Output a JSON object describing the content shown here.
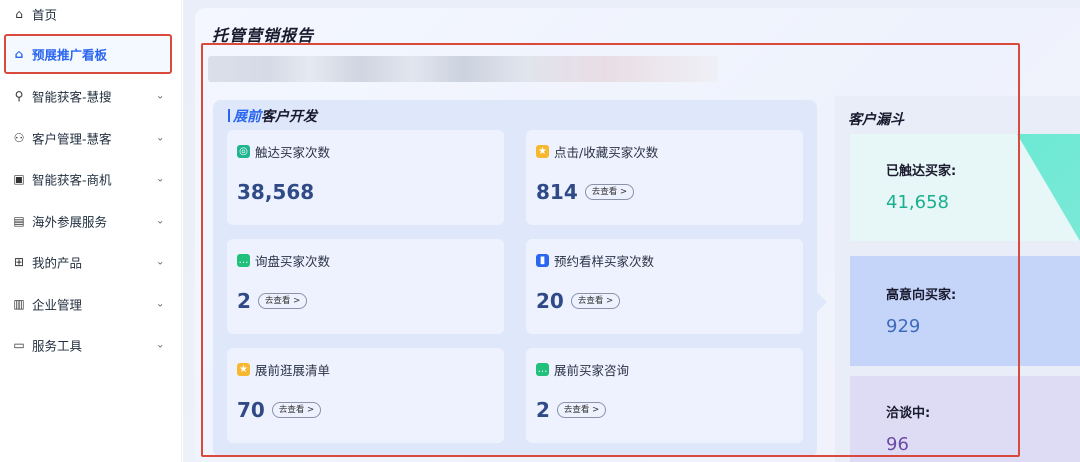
{
  "sidebar": {
    "items": [
      {
        "label": "首页",
        "icon": "home-icon",
        "glyph": "⌂",
        "chevron": ""
      },
      {
        "label": "预展推广看板",
        "icon": "dashboard-icon",
        "glyph": "⌂",
        "chevron": ""
      },
      {
        "label": "智能获客-慧搜",
        "icon": "smart-search-icon",
        "glyph": "⚲",
        "chevron": "⌄"
      },
      {
        "label": "客户管理-慧客",
        "icon": "customer-icon",
        "glyph": "⚇",
        "chevron": "⌄"
      },
      {
        "label": "智能获客-商机",
        "icon": "opportunity-icon",
        "glyph": "▣",
        "chevron": "⌄"
      },
      {
        "label": "海外参展服务",
        "icon": "clipboard-icon",
        "glyph": "▤",
        "chevron": "⌄"
      },
      {
        "label": "我的产品",
        "icon": "product-icon",
        "glyph": "⊞",
        "chevron": "⌄"
      },
      {
        "label": "企业管理",
        "icon": "building-icon",
        "glyph": "▥",
        "chevron": "⌄"
      },
      {
        "label": "服务工具",
        "icon": "toolbox-icon",
        "glyph": "▭",
        "chevron": "⌄"
      }
    ],
    "active_index": 1
  },
  "report": {
    "title": "托管营销报告"
  },
  "section": {
    "title_accent": "展前",
    "title_rest": "客户开发",
    "link_label": "去查看 >",
    "cards": [
      {
        "label": "触达买家次数",
        "value": "38,568",
        "icon": "reach-icon",
        "icon_color": "#1fb58f",
        "glyph": "◎",
        "has_link": false
      },
      {
        "label": "点击/收藏买家次数",
        "value": "814",
        "icon": "star-icon",
        "icon_color": "#f5b82e",
        "glyph": "★",
        "has_link": true
      },
      {
        "label": "询盘买家次数",
        "value": "2",
        "icon": "message-icon",
        "icon_color": "#21c17c",
        "glyph": "…",
        "has_link": true
      },
      {
        "label": "预约看样买家次数",
        "value": "20",
        "icon": "bag-icon",
        "icon_color": "#2a66f0",
        "glyph": "▮",
        "has_link": true
      },
      {
        "label": "展前逛展清单",
        "value": "70",
        "icon": "star-icon",
        "icon_color": "#f5b82e",
        "glyph": "★",
        "has_link": true
      },
      {
        "label": "展前买家咨询",
        "value": "2",
        "icon": "chat-icon",
        "icon_color": "#21c17c",
        "glyph": "…",
        "has_link": true
      }
    ]
  },
  "funnel": {
    "title": "客户漏斗",
    "stages": [
      {
        "label": "已触达买家:",
        "value": "41,658",
        "color": "#19b08e"
      },
      {
        "label": "高意向买家:",
        "value": "929",
        "color": "#3f6bb8"
      },
      {
        "label": "洽谈中:",
        "value": "96",
        "color": "#6b4aa8"
      }
    ]
  }
}
